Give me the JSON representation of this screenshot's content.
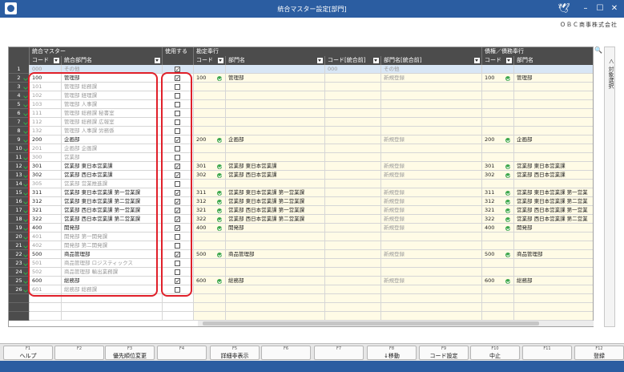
{
  "window": {
    "title": "統合マスター設定[部門]",
    "company": "ＯＢＣ商事株式会社"
  },
  "groups": {
    "g1": "統合マスター",
    "g2": "使用する",
    "g3": "勘定奉行",
    "g4": "債権／債務奉行"
  },
  "headers": {
    "code": "コード",
    "name": "統合部門名",
    "code2": "コード",
    "name2": "部門名",
    "code3": "コード[統合前]",
    "name3": "部門名[統合前]",
    "code4": "コード",
    "name4": "部門名"
  },
  "side_tab": "対象選択",
  "rows": [
    {
      "n": "1",
      "code": "000",
      "name": "その他",
      "use": true,
      "c2": "",
      "n2": "",
      "c3": "000",
      "n3": "その他",
      "c4": "",
      "n4": "",
      "dim": true,
      "sel": true
    },
    {
      "n": "2",
      "code": "100",
      "name": "管理部",
      "use": true,
      "c2": "100",
      "n2": "管理部",
      "c3": "",
      "n3": "新規登録",
      "c4": "100",
      "n4": "管理部",
      "dim": false
    },
    {
      "n": "3",
      "code": "101",
      "name": "管理部 総務課",
      "use": false,
      "c2": "",
      "n2": "",
      "c3": "",
      "n3": "",
      "c4": "",
      "n4": "",
      "dim": true
    },
    {
      "n": "4",
      "code": "102",
      "name": "管理部 経理課",
      "use": false,
      "c2": "",
      "n2": "",
      "c3": "",
      "n3": "",
      "c4": "",
      "n4": "",
      "dim": true
    },
    {
      "n": "5",
      "code": "103",
      "name": "管理部 人事課",
      "use": false,
      "c2": "",
      "n2": "",
      "c3": "",
      "n3": "",
      "c4": "",
      "n4": "",
      "dim": true
    },
    {
      "n": "6",
      "code": "111",
      "name": "管理部 総務課 秘書室",
      "use": false,
      "c2": "",
      "n2": "",
      "c3": "",
      "n3": "",
      "c4": "",
      "n4": "",
      "dim": true
    },
    {
      "n": "7",
      "code": "112",
      "name": "管理部 総務課 広報室",
      "use": false,
      "c2": "",
      "n2": "",
      "c3": "",
      "n3": "",
      "c4": "",
      "n4": "",
      "dim": true
    },
    {
      "n": "8",
      "code": "132",
      "name": "管理部 人事課 労務係",
      "use": false,
      "c2": "",
      "n2": "",
      "c3": "",
      "n3": "",
      "c4": "",
      "n4": "",
      "dim": true
    },
    {
      "n": "9",
      "code": "200",
      "name": "企画部",
      "use": true,
      "c2": "200",
      "n2": "企画部",
      "c3": "",
      "n3": "新規登録",
      "c4": "200",
      "n4": "企画部",
      "dim": false
    },
    {
      "n": "10",
      "code": "201",
      "name": "企画部 企画課",
      "use": false,
      "c2": "",
      "n2": "",
      "c3": "",
      "n3": "",
      "c4": "",
      "n4": "",
      "dim": true
    },
    {
      "n": "11",
      "code": "300",
      "name": "営業部",
      "use": false,
      "c2": "",
      "n2": "",
      "c3": "",
      "n3": "",
      "c4": "",
      "n4": "",
      "dim": true
    },
    {
      "n": "12",
      "code": "301",
      "name": "営業部 東日本営業課",
      "use": true,
      "c2": "301",
      "n2": "営業部 東日本営業課",
      "c3": "",
      "n3": "新規登録",
      "c4": "301",
      "n4": "営業部 東日本営業課",
      "dim": false
    },
    {
      "n": "13",
      "code": "302",
      "name": "営業部 西日本営業課",
      "use": true,
      "c2": "302",
      "n2": "営業部 西日本営業課",
      "c3": "",
      "n3": "新規登録",
      "c4": "302",
      "n4": "営業部 西日本営業課",
      "dim": false
    },
    {
      "n": "14",
      "code": "305",
      "name": "営業部 営業推進課",
      "use": false,
      "c2": "",
      "n2": "",
      "c3": "",
      "n3": "",
      "c4": "",
      "n4": "",
      "dim": true
    },
    {
      "n": "15",
      "code": "311",
      "name": "営業部 東日本営業課 第一営業課",
      "use": true,
      "c2": "311",
      "n2": "営業部 東日本営業課 第一営業課",
      "c3": "",
      "n3": "新規登録",
      "c4": "311",
      "n4": "営業部 東日本営業課 第一営業",
      "dim": false
    },
    {
      "n": "16",
      "code": "312",
      "name": "営業部 東日本営業課 第二営業課",
      "use": true,
      "c2": "312",
      "n2": "営業部 東日本営業課 第二営業課",
      "c3": "",
      "n3": "新規登録",
      "c4": "312",
      "n4": "営業部 東日本営業課 第二営業",
      "dim": false
    },
    {
      "n": "17",
      "code": "321",
      "name": "営業部 西日本営業課 第一営業課",
      "use": true,
      "c2": "321",
      "n2": "営業部 西日本営業課 第一営業課",
      "c3": "",
      "n3": "新規登録",
      "c4": "321",
      "n4": "営業部 西日本営業課 第一営業",
      "dim": false
    },
    {
      "n": "18",
      "code": "322",
      "name": "営業部 西日本営業課 第二営業課",
      "use": true,
      "c2": "322",
      "n2": "営業部 西日本営業課 第二営業課",
      "c3": "",
      "n3": "新規登録",
      "c4": "322",
      "n4": "営業部 西日本営業課 第二営業",
      "dim": false
    },
    {
      "n": "19",
      "code": "400",
      "name": "開発部",
      "use": true,
      "c2": "400",
      "n2": "開発部",
      "c3": "",
      "n3": "新規登録",
      "c4": "400",
      "n4": "開発部",
      "dim": false
    },
    {
      "n": "20",
      "code": "401",
      "name": "開発部 第一開発課",
      "use": false,
      "c2": "",
      "n2": "",
      "c3": "",
      "n3": "",
      "c4": "",
      "n4": "",
      "dim": true
    },
    {
      "n": "21",
      "code": "402",
      "name": "開発部 第二開発課",
      "use": false,
      "c2": "",
      "n2": "",
      "c3": "",
      "n3": "",
      "c4": "",
      "n4": "",
      "dim": true
    },
    {
      "n": "22",
      "code": "500",
      "name": "商品管理部",
      "use": true,
      "c2": "500",
      "n2": "商品管理部",
      "c3": "",
      "n3": "新規登録",
      "c4": "500",
      "n4": "商品管理部",
      "dim": false
    },
    {
      "n": "23",
      "code": "501",
      "name": "商品管理部 ロジスティックス",
      "use": false,
      "c2": "",
      "n2": "",
      "c3": "",
      "n3": "",
      "c4": "",
      "n4": "",
      "dim": true
    },
    {
      "n": "24",
      "code": "502",
      "name": "商品管理部 輸出業務課",
      "use": false,
      "c2": "",
      "n2": "",
      "c3": "",
      "n3": "",
      "c4": "",
      "n4": "",
      "dim": true
    },
    {
      "n": "25",
      "code": "600",
      "name": "総務部",
      "use": true,
      "c2": "600",
      "n2": "総務部",
      "c3": "",
      "n3": "新規登録",
      "c4": "600",
      "n4": "総務部",
      "dim": false
    },
    {
      "n": "26",
      "code": "601",
      "name": "総務部 総務課",
      "use": false,
      "c2": "",
      "n2": "",
      "c3": "",
      "n3": "",
      "c4": "",
      "n4": "",
      "dim": true
    }
  ],
  "fkeys": [
    {
      "k": "F1",
      "l": "ヘルプ"
    },
    {
      "k": "F2",
      "l": ""
    },
    {
      "k": "F3",
      "l": "優先順位変更"
    },
    {
      "k": "F4",
      "l": ""
    },
    {
      "k": "F5",
      "l": "詳細非表示"
    },
    {
      "k": "F6",
      "l": ""
    },
    {
      "k": "F7",
      "l": ""
    },
    {
      "k": "F8",
      "l": "↓移動"
    },
    {
      "k": "F9",
      "l": "コード設定"
    },
    {
      "k": "F10",
      "l": "中止"
    },
    {
      "k": "F11",
      "l": ""
    },
    {
      "k": "F12",
      "l": "登録"
    }
  ]
}
